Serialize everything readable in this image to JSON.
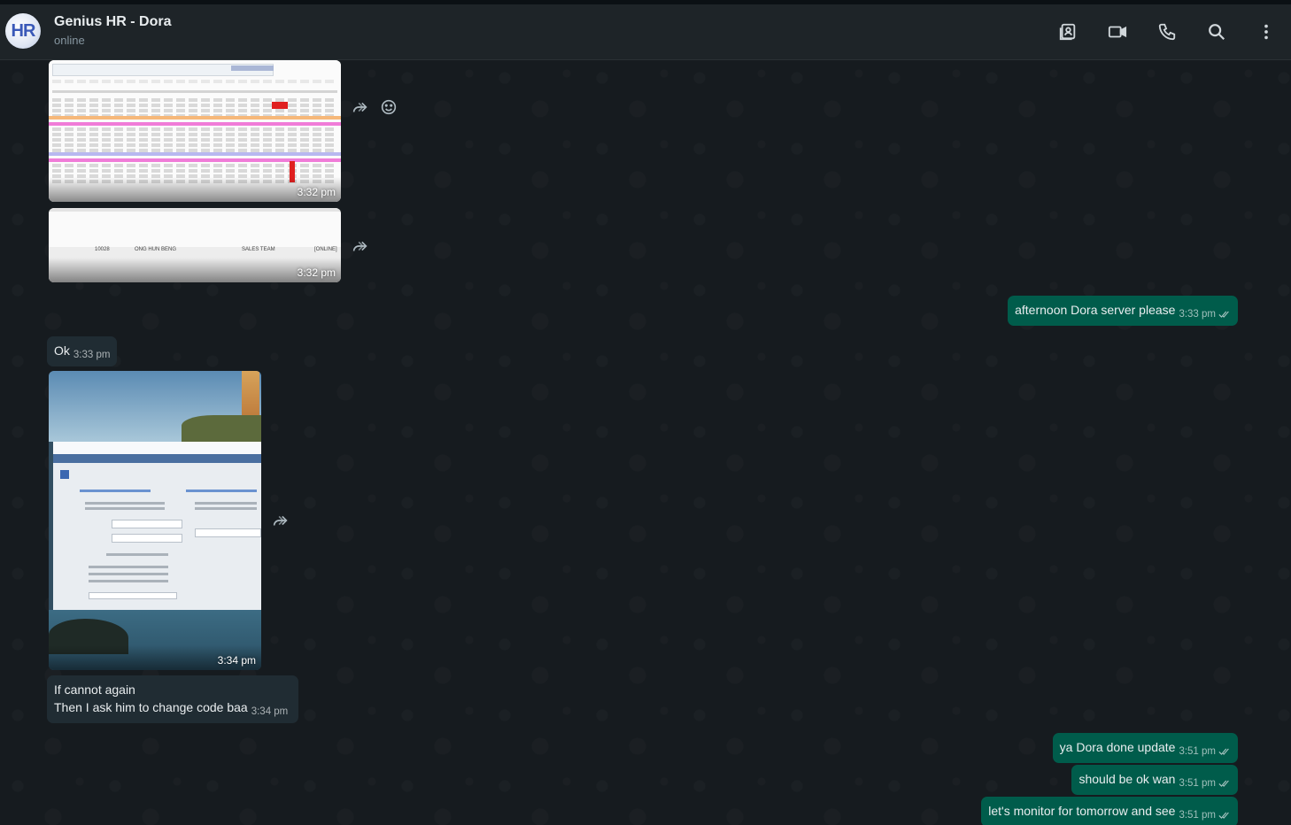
{
  "header": {
    "avatar_text": "HR",
    "title": "Genius HR - Dora",
    "status": "online",
    "icons": [
      "contact-card-icon",
      "video-call-icon",
      "voice-call-icon",
      "search-icon",
      "more-options-icon"
    ]
  },
  "colors": {
    "header_bg": "#1e2428",
    "chat_bg": "#161b1f",
    "incoming_bubble": "#202c33",
    "outgoing_bubble": "#005c4b",
    "read_ticks": "#e9edef"
  },
  "messages": {
    "img1": {
      "time": "3:32 pm"
    },
    "img2": {
      "time": "3:32 pm",
      "caption_id": "10028",
      "caption_name": "ONG HUN BENG",
      "caption_team": "SALES TEAM",
      "caption_status": "[ONLINE]"
    },
    "out1": {
      "text": "afternoon Dora server please",
      "time": "3:33 pm"
    },
    "in1": {
      "text": "Ok",
      "time": "3:33 pm"
    },
    "img3": {
      "time": "3:34 pm"
    },
    "in2": {
      "line1": "If cannot again",
      "line2": "Then I ask him to change code baa",
      "time": "3:34 pm"
    },
    "out2": {
      "text": "ya Dora done update",
      "time": "3:51 pm"
    },
    "out3": {
      "text": "should be ok wan",
      "time": "3:51 pm"
    },
    "out4": {
      "text": "let's monitor for tomorrow and see",
      "time": "3:51 pm"
    }
  }
}
